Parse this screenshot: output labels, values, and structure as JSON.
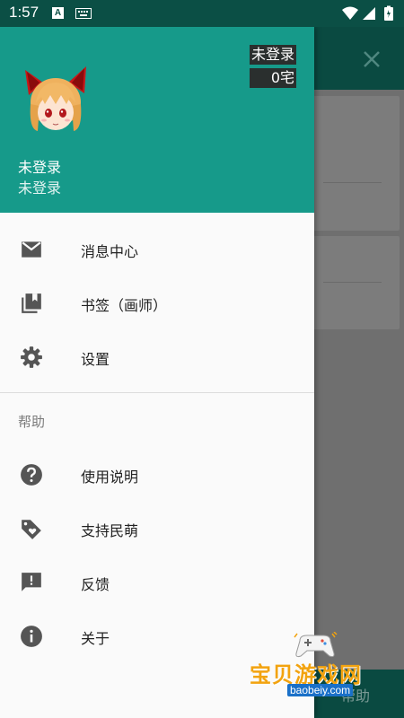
{
  "status_bar": {
    "time": "1:57",
    "icons": [
      "a-box-icon",
      "keyboard-icon",
      "wifi-icon",
      "signal-icon",
      "battery-icon"
    ]
  },
  "background": {
    "bottom_text": "帮助"
  },
  "drawer": {
    "header": {
      "user_name": "未登录",
      "user_sub": "未登录",
      "login_badge": "未登录",
      "coin_badge": "0宅",
      "color": "#169a8a"
    },
    "items": [
      {
        "label": "消息中心",
        "icon": "mail-icon"
      },
      {
        "label": "书签（画师）",
        "icon": "bookmarks-icon"
      },
      {
        "label": "设置",
        "icon": "gear-icon"
      }
    ],
    "help_section_title": "帮助",
    "help_items": [
      {
        "label": "使用说明",
        "icon": "help-circle-icon"
      },
      {
        "label": "支持民萌",
        "icon": "tag-heart-icon"
      },
      {
        "label": "反馈",
        "icon": "feedback-icon"
      },
      {
        "label": "关于",
        "icon": "info-icon"
      }
    ]
  },
  "watermark": {
    "title": "宝贝游戏网",
    "url": "baobeiy.com"
  }
}
